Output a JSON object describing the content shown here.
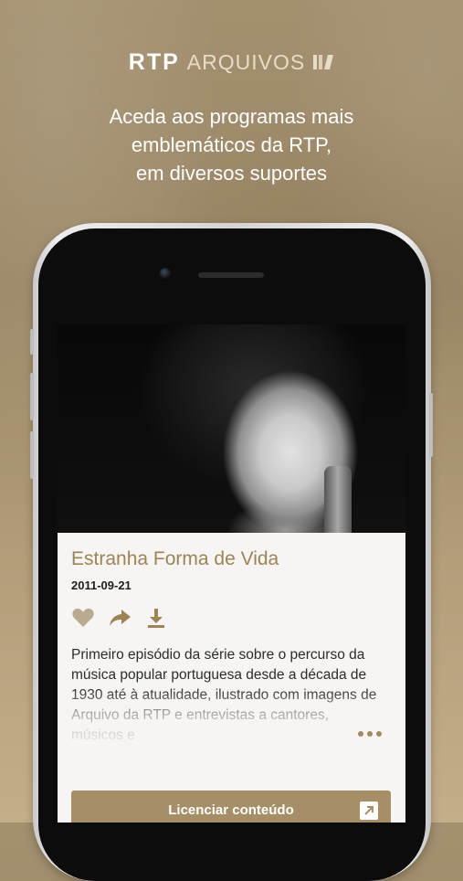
{
  "header": {
    "brand_rtp": "RTP",
    "brand_arquivos": "ARQUIVOS",
    "tagline_lines": [
      "Aceda aos programas mais",
      "emblemáticos da RTP,",
      "em diversos suportes"
    ]
  },
  "content": {
    "title": "Estranha Forma de Vida",
    "date": "2011-09-21",
    "actions": [
      "heart-icon",
      "share-icon",
      "download-icon"
    ],
    "description": "Primeiro episódio da série sobre o percurso da música popular portuguesa desde a década de 1930 até à atualidade, ilustrado com imagens de Arquivo da RTP e entrevistas a cantores, músicos e",
    "license_label": "Licenciar conteúdo"
  },
  "colors": {
    "accent": "#a68f66",
    "title": "#9e8455",
    "background": "#a3906f"
  }
}
